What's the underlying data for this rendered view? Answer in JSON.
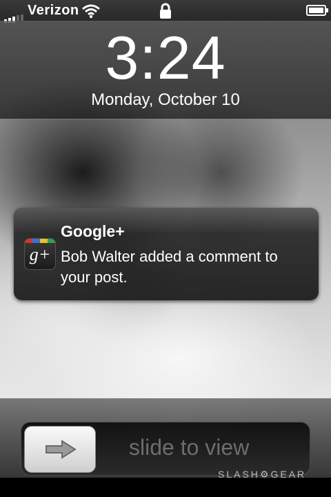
{
  "status_bar": {
    "carrier": "Verizon",
    "icons": [
      "signal-bars-icon",
      "wifi-icon",
      "lock-icon",
      "battery-icon"
    ]
  },
  "lock_screen": {
    "time": "3:24",
    "date": "Monday, October 10"
  },
  "notification": {
    "app_icon": "google-plus-icon",
    "app_icon_glyph": "g+",
    "title": "Google+",
    "message": "Bob Walter added a comment to your post."
  },
  "unlock_slider": {
    "label": "slide to view",
    "knob_icon": "arrow-right-icon"
  },
  "watermark": "SLASH⚙GEAR",
  "colors": {
    "google_bar": [
      "#d8322a",
      "#3a6fd8",
      "#f0c020",
      "#35a04a"
    ],
    "slider_text": "#6d6d6d"
  }
}
